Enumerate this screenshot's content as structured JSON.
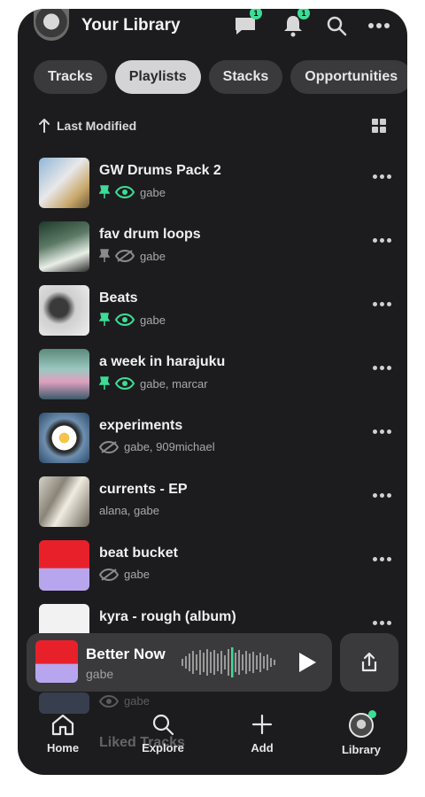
{
  "header": {
    "title": "Your Library",
    "messages_badge": "1",
    "notifications_badge": "1"
  },
  "tabs": [
    {
      "label": "Tracks",
      "active": false
    },
    {
      "label": "Playlists",
      "active": true
    },
    {
      "label": "Stacks",
      "active": false
    },
    {
      "label": "Opportunities",
      "active": false
    }
  ],
  "sort": {
    "label": "Last Modified"
  },
  "items": [
    {
      "title": "GW Drums Pack 2",
      "meta": "gabe",
      "pinned": true,
      "visibility": "visible"
    },
    {
      "title": "fav drum loops",
      "meta": "gabe",
      "pinned": true,
      "visibility": "hidden"
    },
    {
      "title": "Beats",
      "meta": "gabe",
      "pinned": true,
      "visibility": "visible"
    },
    {
      "title": "a week in harajuku",
      "meta": "gabe, marcar",
      "pinned": true,
      "visibility": "visible"
    },
    {
      "title": "experiments",
      "meta": "gabe, 909michael",
      "pinned": false,
      "visibility": "hidden"
    },
    {
      "title": "currents - EP",
      "meta": "alana, gabe",
      "pinned": false,
      "visibility": "none"
    },
    {
      "title": "beat bucket",
      "meta": "gabe",
      "pinned": false,
      "visibility": "hidden"
    },
    {
      "title": "kyra - rough (album)",
      "meta": "",
      "pinned": false,
      "visibility": "none"
    }
  ],
  "faded_row": {
    "meta": "gabe",
    "title": "Liked Tracks"
  },
  "player": {
    "title": "Better Now",
    "artist": "gabe"
  },
  "nav": [
    {
      "label": "Home",
      "icon": "home-icon"
    },
    {
      "label": "Explore",
      "icon": "search-icon"
    },
    {
      "label": "Add",
      "icon": "plus-icon"
    },
    {
      "label": "Library",
      "icon": "library-icon"
    }
  ],
  "colors": {
    "accent": "#3ddc97",
    "background": "#1c1c1e",
    "pill": "#3a3a3c",
    "pill_active": "#d4d4d6"
  }
}
